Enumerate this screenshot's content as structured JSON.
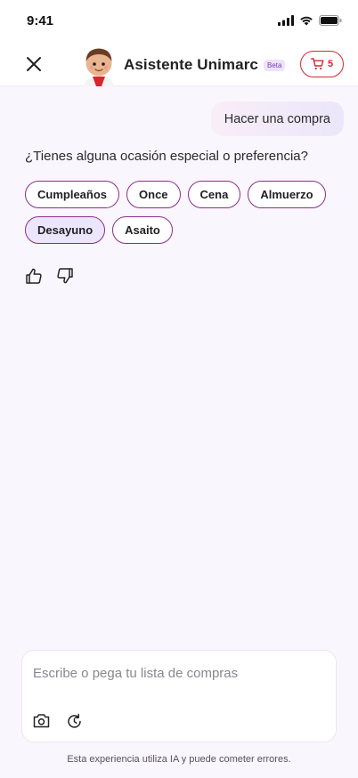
{
  "status_bar": {
    "time": "9:41"
  },
  "header": {
    "title": "Asistente Unimarc",
    "badge": "Beta",
    "cart_count": "5",
    "accent_color": "#d8262e"
  },
  "chat": {
    "user_message": "Hacer una compra",
    "assistant_question": "¿Tienes alguna ocasión especial o preferencia?",
    "options_row1": [
      "Cumpleaños",
      "Once",
      "Cena",
      "Almuerzo"
    ],
    "options_row2": [
      "Desayuno",
      "Asaito"
    ],
    "selected_option": "Desayuno",
    "chip_border_color": "#8d2c8c"
  },
  "composer": {
    "placeholder": "Escribe o pega tu lista de compras"
  },
  "footer": {
    "disclaimer": "Esta experiencia utiliza IA y puede cometer errores."
  }
}
